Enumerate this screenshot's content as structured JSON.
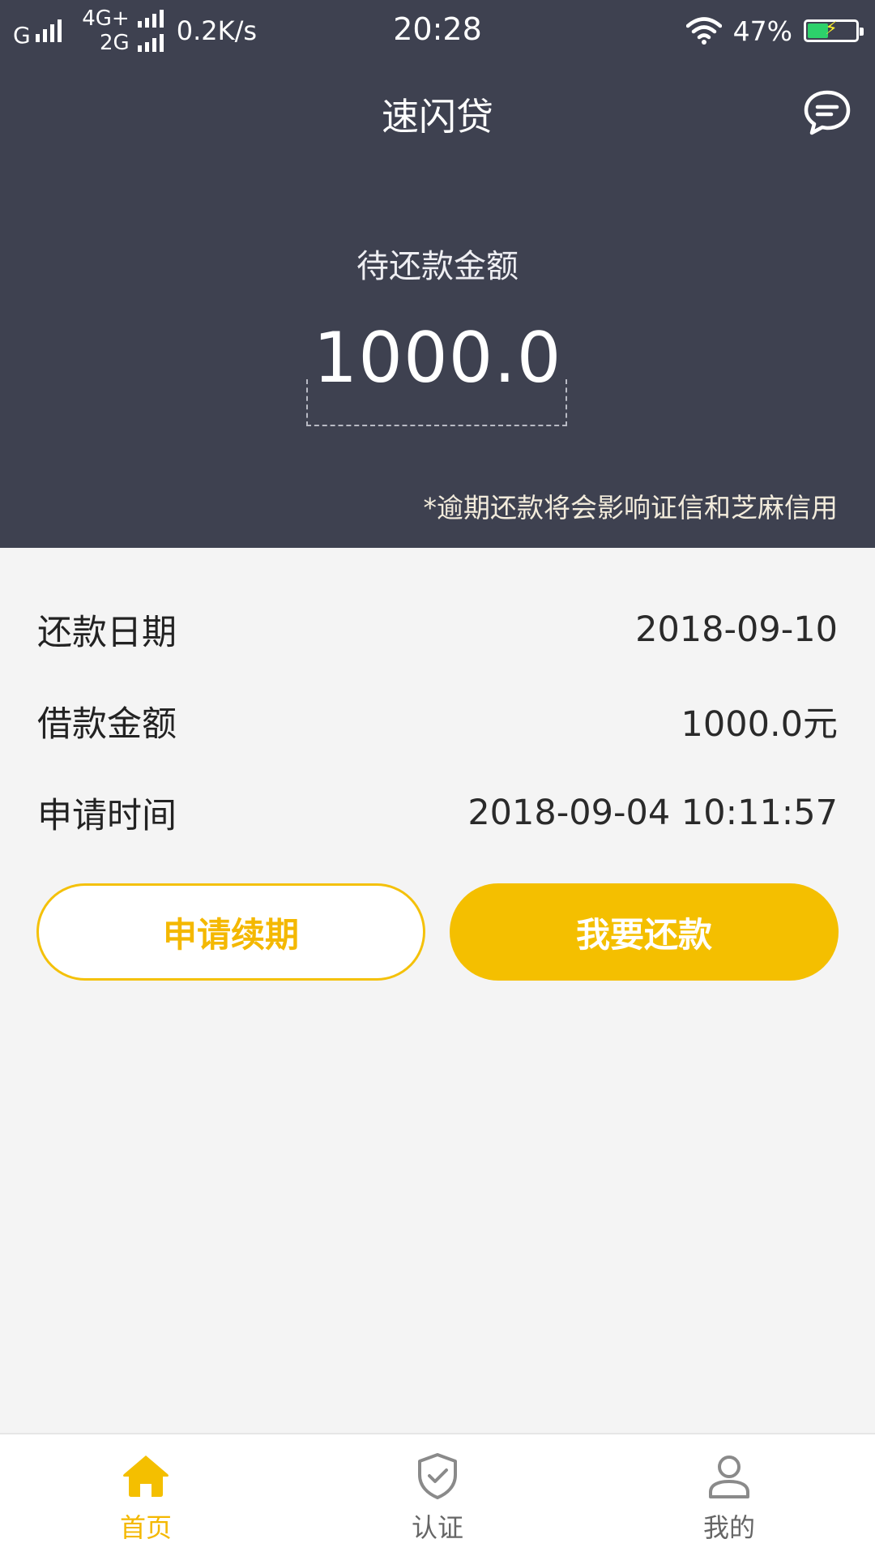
{
  "status_bar": {
    "carrier1": "G",
    "net_top": "4G+",
    "net_bottom": "2G",
    "speed": "0.2K/s",
    "time": "20:28",
    "battery": "47%",
    "battery_level": 0.47
  },
  "header": {
    "title": "速闪贷",
    "message_icon": "chat-bubble-icon"
  },
  "summary": {
    "label": "待还款金额",
    "amount": "1000.0",
    "notice": "*逾期还款将会影响证信和芝麻信用"
  },
  "info_rows": [
    {
      "label": "还款日期",
      "value": "2018-09-10"
    },
    {
      "label": "借款金额",
      "value": "1000.0元"
    },
    {
      "label": "申请时间",
      "value": "2018-09-04 10:11:57"
    }
  ],
  "actions": {
    "renew_label": "申请续期",
    "repay_label": "我要还款"
  },
  "tabs": [
    {
      "label": "首页",
      "icon": "home-icon",
      "active": true
    },
    {
      "label": "认证",
      "icon": "shield-check-icon",
      "active": false
    },
    {
      "label": "我的",
      "icon": "user-icon",
      "active": false
    }
  ],
  "colors": {
    "header_bg": "#3e4150",
    "accent": "#f4bf00",
    "page_bg": "#f4f4f4"
  }
}
